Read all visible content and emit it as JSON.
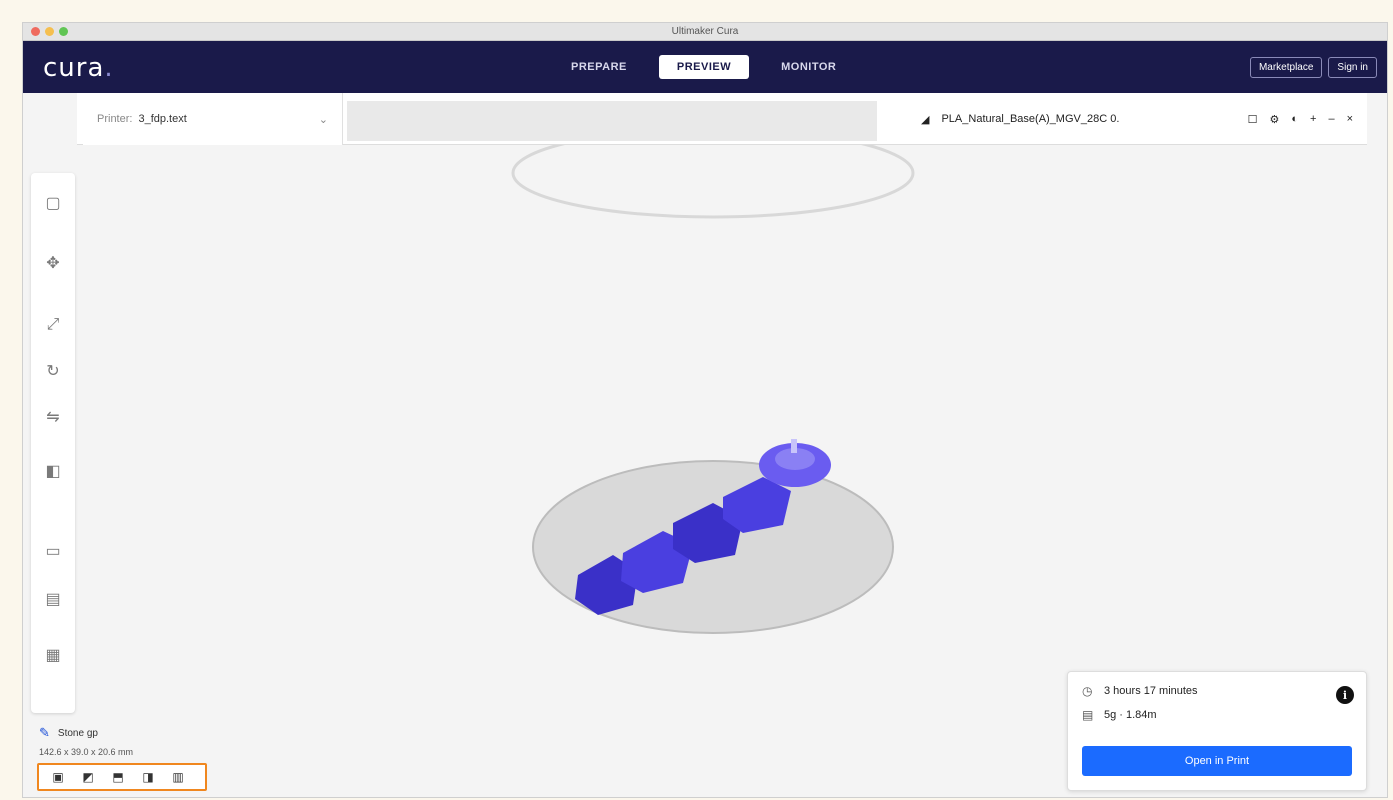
{
  "window": {
    "title": "Ultimaker Cura"
  },
  "header": {
    "logo": "cura",
    "logo_dot": ".",
    "tabs": [
      {
        "label": "PREPARE",
        "active": false
      },
      {
        "label": "PREVIEW",
        "active": true
      },
      {
        "label": "MONITOR",
        "active": false
      }
    ],
    "right_buttons": [
      "Marketplace",
      "Sign in"
    ]
  },
  "printer": {
    "label": "Printer:",
    "value": "3_fdp.text",
    "chevron": "⌄"
  },
  "material": {
    "icon": "filament-icon",
    "value": "PLA_Natural_Base(A)_MGV_28C 0.",
    "icons": [
      "☐",
      "⚙",
      "◐"
    ]
  },
  "window_controls": [
    "+",
    "–",
    "×"
  ],
  "object": {
    "name": "Stone gp",
    "dimensions": "142.6 x 39.0 x 20.6 mm"
  },
  "view_buttons": [
    "▣",
    "◩",
    "⬒",
    "◨",
    "▥"
  ],
  "print_panel": {
    "time": "3 hours 17 minutes",
    "material": "5g · 1.84m",
    "info": "i",
    "preview_button": "Open in Print"
  },
  "colors": {
    "accent": "#1b6bff",
    "header": "#1a1a4a",
    "model": "#4a3fe0",
    "highlight": "#f0871f"
  }
}
